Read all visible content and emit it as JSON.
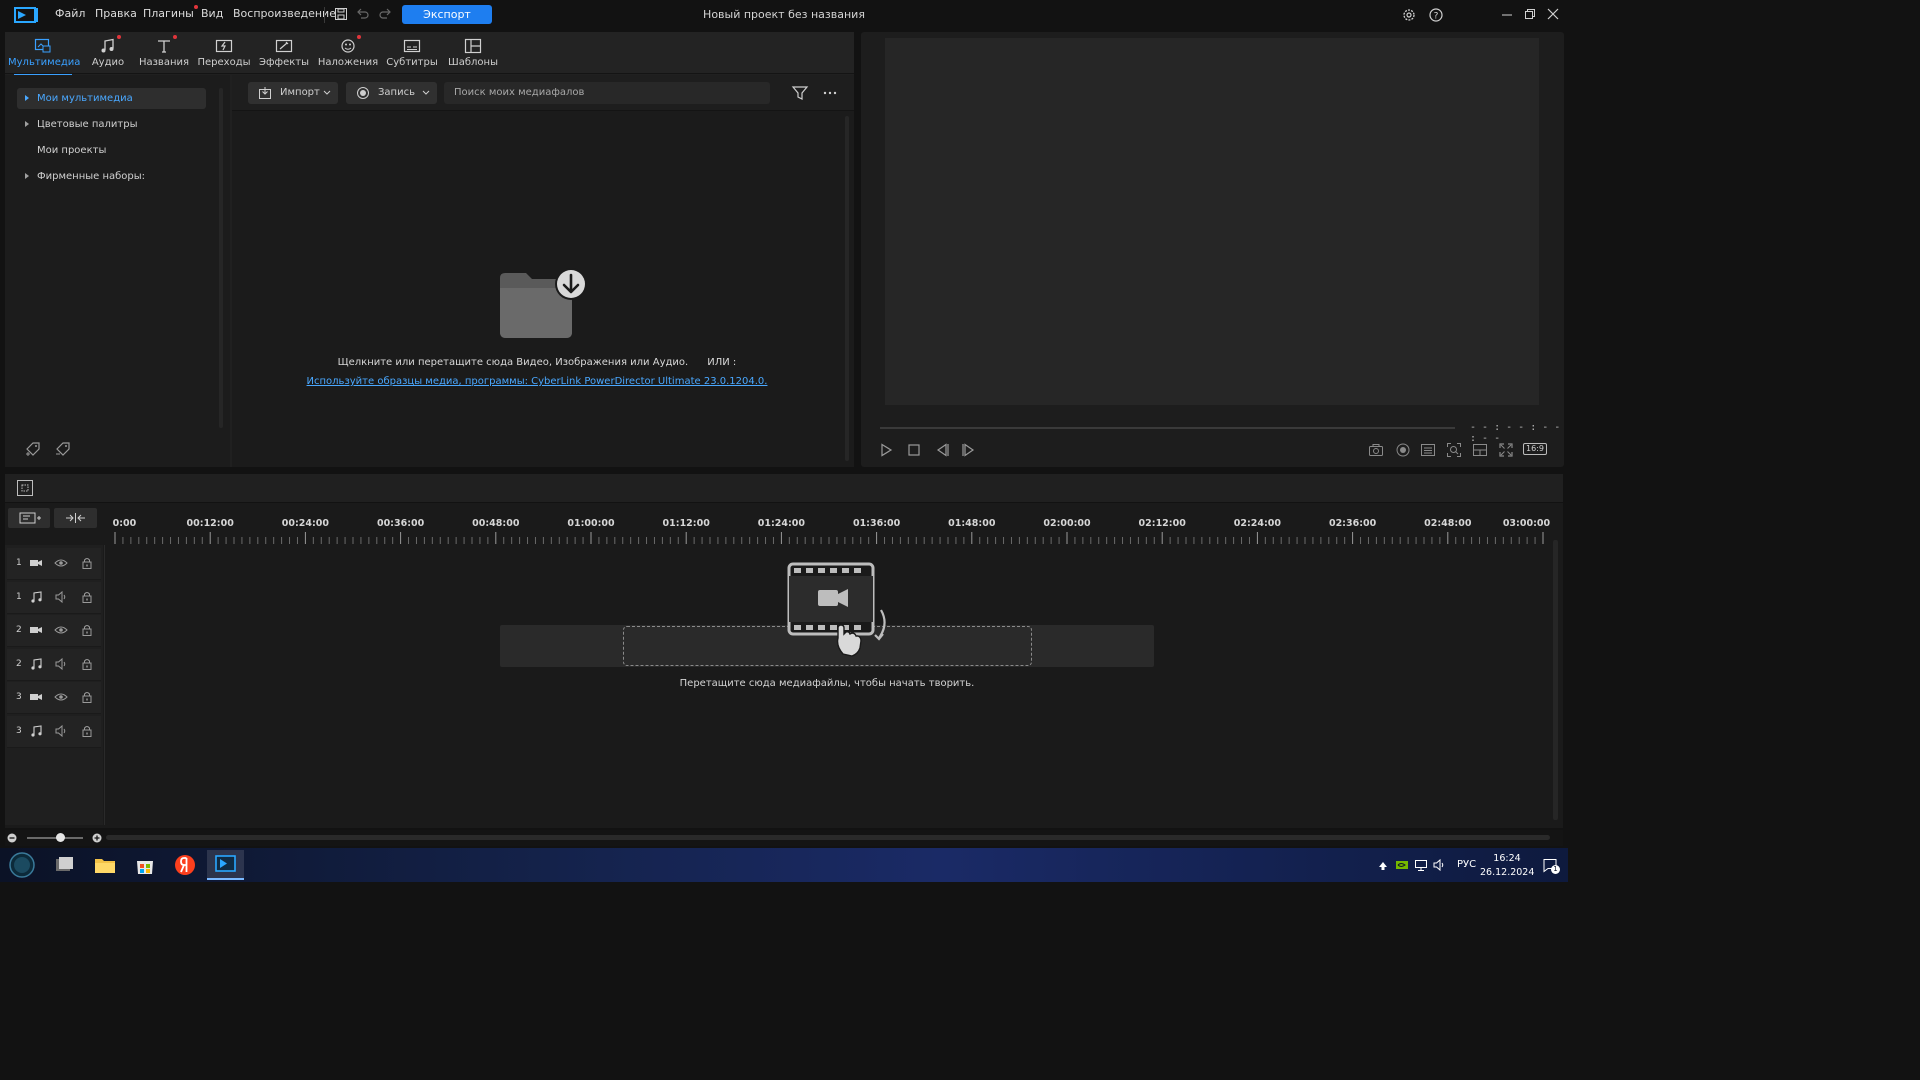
{
  "app": {
    "project_title": "Новый проект без названия",
    "export_label": "Экспорт"
  },
  "menu": [
    "Файл",
    "Правка",
    "Плагины",
    "Вид",
    "Воспроизведение"
  ],
  "tabs": [
    {
      "label": "Мультимедиа",
      "icon": "media-icon",
      "active": true
    },
    {
      "label": "Аудио",
      "icon": "music-note-icon",
      "dot": true
    },
    {
      "label": "Названия",
      "icon": "text-icon",
      "dot": true
    },
    {
      "label": "Переходы",
      "icon": "transition-icon"
    },
    {
      "label": "Эффекты",
      "icon": "effects-icon"
    },
    {
      "label": "Наложения",
      "icon": "overlay-icon",
      "dot": true
    },
    {
      "label": "Субтитры",
      "icon": "subtitles-icon"
    },
    {
      "label": "Шаблоны",
      "icon": "templates-icon"
    }
  ],
  "tree": [
    {
      "label": "Мои мультимедиа",
      "selected": true,
      "expandable": true
    },
    {
      "label": "Цветовые палитры",
      "expandable": true
    },
    {
      "label": "Мои проекты",
      "expandable": false
    },
    {
      "label": "Фирменные наборы:",
      "expandable": true
    }
  ],
  "media_toolbar": {
    "import_label": "Импорт",
    "record_label": "Запись",
    "search_placeholder": "Поиск моих медиафалов"
  },
  "media_area": {
    "hint": "Щелкните или перетащите сюда Видео, Изображения или Аудио.      ИЛИ :",
    "sample_link": "Используйте образцы медиа, программы: CyberLink PowerDirector Ultimate 23.0.1204.0."
  },
  "preview": {
    "timecode": "- - : - - : - - : - -",
    "aspect_ratio": "16:9"
  },
  "timeline": {
    "ruler": [
      "0:00",
      "00:12:00",
      "00:24:00",
      "00:36:00",
      "00:48:00",
      "01:00:00",
      "01:12:00",
      "01:24:00",
      "01:36:00",
      "01:48:00",
      "02:00:00",
      "02:12:00",
      "02:24:00",
      "02:36:00",
      "02:48:00",
      "03:00:00"
    ],
    "tracks": [
      {
        "num": "1",
        "type": "video"
      },
      {
        "num": "1",
        "type": "audio"
      },
      {
        "num": "2",
        "type": "video"
      },
      {
        "num": "2",
        "type": "audio"
      },
      {
        "num": "3",
        "type": "video"
      },
      {
        "num": "3",
        "type": "audio"
      }
    ],
    "drop_hint": "Перетащите сюда медиафайлы, чтобы начать творить."
  },
  "taskbar": {
    "lang": "РУС",
    "time": "16:24",
    "date": "26.12.2024",
    "notification_count": "1"
  },
  "colors": {
    "accent": "#1e7ef0",
    "link": "#4aa8ff",
    "badge_dot": "#e0353b"
  }
}
